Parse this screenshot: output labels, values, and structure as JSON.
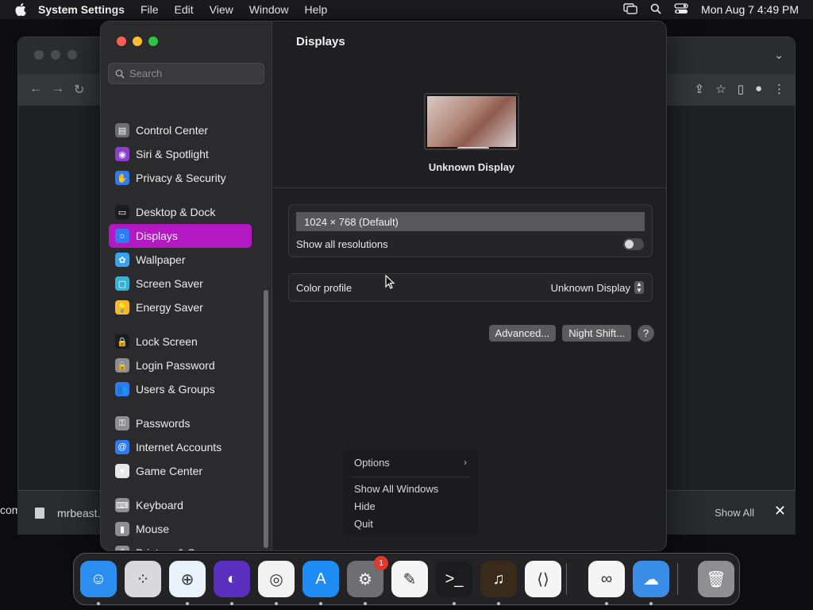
{
  "menubar": {
    "app_name": "System Settings",
    "items": [
      "File",
      "Edit",
      "View",
      "Window",
      "Help"
    ],
    "clock": "Mon Aug 7  4:49 PM"
  },
  "browser": {
    "download_file": "mrbeast.",
    "show_all": "Show All",
    "left_edge_text": "com"
  },
  "settings": {
    "search_placeholder": "Search",
    "sidebar": [
      {
        "label": "Control Center",
        "color": "#6e6e73",
        "icon": "control-center-icon"
      },
      {
        "label": "Siri & Spotlight",
        "color": "#8a3fd1",
        "icon": "siri-icon"
      },
      {
        "label": "Privacy & Security",
        "color": "#2f7bf6",
        "icon": "hand-icon"
      },
      {
        "label": "Desktop & Dock",
        "color": "#1c1c1e",
        "icon": "dock-icon"
      },
      {
        "label": "Displays",
        "color": "#2f7bf6",
        "icon": "sun-icon"
      },
      {
        "label": "Wallpaper",
        "color": "#36a3f5",
        "icon": "flower-icon"
      },
      {
        "label": "Screen Saver",
        "color": "#35b3d6",
        "icon": "screen-saver-icon"
      },
      {
        "label": "Energy Saver",
        "color": "#f6b92e",
        "icon": "lightbulb-icon"
      },
      {
        "label": "Lock Screen",
        "color": "#1c1c1e",
        "icon": "lock-icon"
      },
      {
        "label": "Login Password",
        "color": "#8e8e93",
        "icon": "lock-icon"
      },
      {
        "label": "Users & Groups",
        "color": "#2f7bf6",
        "icon": "users-icon"
      },
      {
        "label": "Passwords",
        "color": "#8e8e93",
        "icon": "key-icon"
      },
      {
        "label": "Internet Accounts",
        "color": "#2f7bf6",
        "icon": "at-icon"
      },
      {
        "label": "Game Center",
        "color": "#e8e8ea",
        "icon": "game-center-icon"
      },
      {
        "label": "Keyboard",
        "color": "#8e8e93",
        "icon": "keyboard-icon"
      },
      {
        "label": "Mouse",
        "color": "#8e8e93",
        "icon": "mouse-icon"
      },
      {
        "label": "Printers & Scanners",
        "color": "#8e8e93",
        "icon": "printer-icon"
      }
    ],
    "active_index": 4,
    "content": {
      "title": "Displays",
      "display_name": "Unknown Display",
      "resolution": "1024 × 768 (Default)",
      "show_all_resolutions": "Show all resolutions",
      "show_all_resolutions_enabled": false,
      "color_profile_label": "Color profile",
      "color_profile_value": "Unknown Display",
      "advanced_button": "Advanced...",
      "night_shift_button": "Night Shift...",
      "help_button": "?"
    }
  },
  "context_menu": {
    "options": "Options",
    "show_all_windows": "Show All Windows",
    "hide": "Hide",
    "quit": "Quit"
  },
  "dock": {
    "apps": [
      {
        "name": "finder",
        "color": "#2b8ef0"
      },
      {
        "name": "launchpad",
        "color": "#d9d9dd"
      },
      {
        "name": "safari",
        "color": "#e8f2fb"
      },
      {
        "name": "firefox",
        "color": "#5a2fbf"
      },
      {
        "name": "chrome",
        "color": "#f2f2f2"
      },
      {
        "name": "app-store",
        "color": "#1d8df5"
      },
      {
        "name": "system-settings",
        "color": "#6e6e73",
        "badge": "1"
      },
      {
        "name": "textedit",
        "color": "#f5f5f5"
      },
      {
        "name": "terminal",
        "color": "#1c1c1e"
      },
      {
        "name": "garageband",
        "color": "#3a2a1a"
      },
      {
        "name": "vscode",
        "color": "#f5f5f5"
      },
      {
        "name": "visual-studio",
        "color": "#f5f5f5"
      },
      {
        "name": "weather",
        "color": "#3a8ee8"
      },
      {
        "name": "trash",
        "color": "#8e8e93"
      }
    ]
  }
}
